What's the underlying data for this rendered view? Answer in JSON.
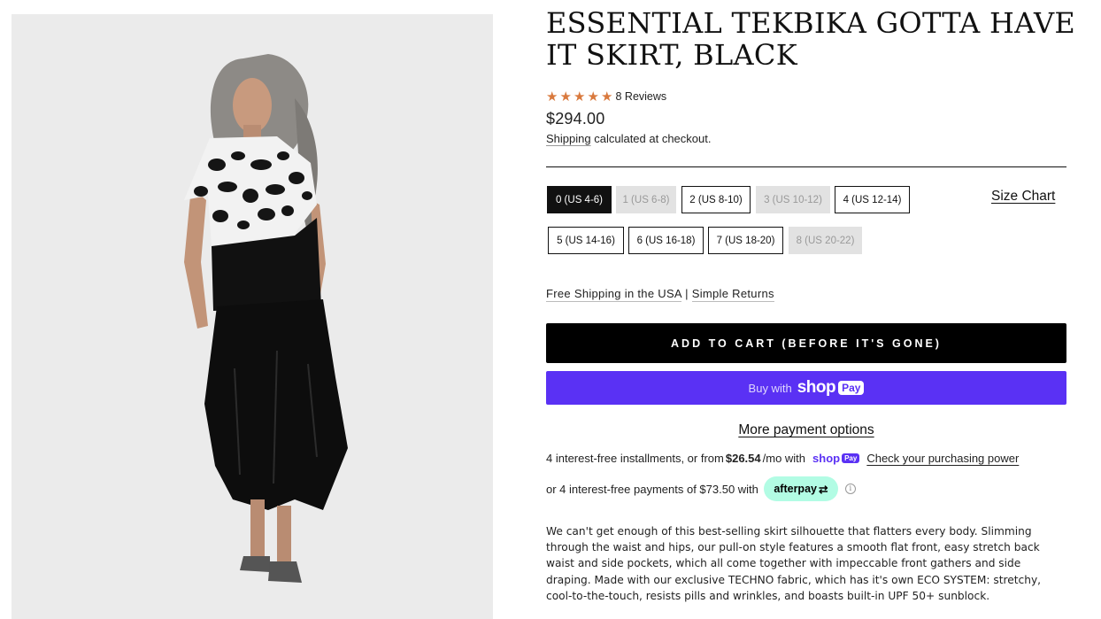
{
  "product": {
    "title": "ESSENTIAL TEKBIKA GOTTA HAVE IT SKIRT, BLACK",
    "rating": 5,
    "rating_max": 5,
    "reviews_label": "8 Reviews",
    "price": "$294.00",
    "shipping_link": "Shipping",
    "shipping_rest": " calculated at checkout."
  },
  "sizes": [
    {
      "label": "0 (US 4-6)",
      "state": "selected"
    },
    {
      "label": "1 (US 6-8)",
      "state": "unavailable"
    },
    {
      "label": "2 (US 8-10)",
      "state": "available"
    },
    {
      "label": "3 (US 10-12)",
      "state": "unavailable"
    },
    {
      "label": "4 (US 12-14)",
      "state": "available"
    },
    {
      "label": "5 (US 14-16)",
      "state": "available"
    },
    {
      "label": "6 (US 16-18)",
      "state": "available"
    },
    {
      "label": "7 (US 18-20)",
      "state": "available"
    },
    {
      "label": "8 (US 20-22)",
      "state": "unavailable"
    }
  ],
  "size_chart_label": "Size Chart",
  "perks": {
    "free_shipping": "Free Shipping in the USA",
    "separator": "|",
    "returns": "Simple Returns"
  },
  "buttons": {
    "add_to_cart": "ADD TO CART (BEFORE IT'S GONE)",
    "buy_with": "Buy with",
    "shop_word": "shop",
    "pay_pill": "Pay",
    "more_payment_options": "More payment options"
  },
  "installments": {
    "prefix": "4 interest-free installments, or from",
    "amount": "$26.54",
    "suffix": "/mo with",
    "brand": "shop",
    "brand_pill": "Pay",
    "link": "Check your purchasing power"
  },
  "afterpay": {
    "text": "or 4 interest-free payments of $73.50 with",
    "badge": "afterpay",
    "info": "i"
  },
  "description": "We can't get enough of this best-selling skirt silhouette that flatters every body. Slimming through the waist and hips, our pull-on style features a smooth flat front, easy stretch back waist and side pockets, which all come together with impeccable front gathers and side draping. Made with our exclusive TECHNO fabric, which has it's own ECO SYSTEM: stretchy, cool-to-the-touch, resists pills and wrinkles, and boasts built-in UPF 50+ sunblock.",
  "colors": {
    "star": "#d9793d",
    "shop_pay": "#5a31f4",
    "afterpay": "#b2fce4"
  }
}
